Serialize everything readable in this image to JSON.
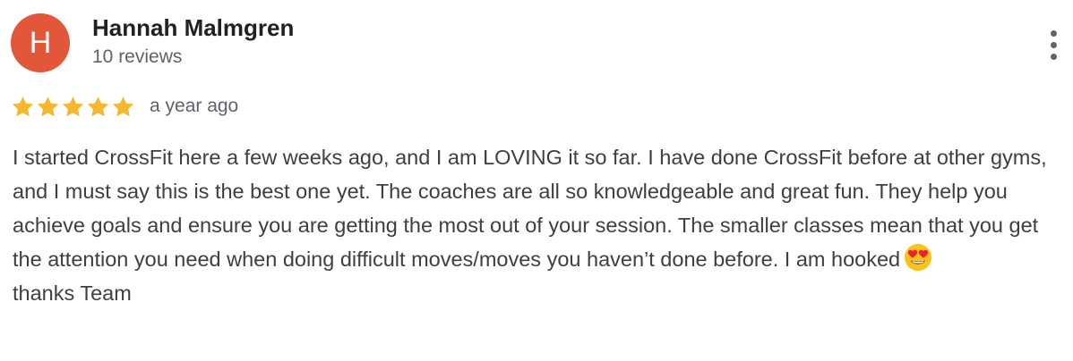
{
  "review": {
    "avatar_initial": "H",
    "avatar_color": "#e2563a",
    "author_name": "Hannah Malmgren",
    "review_count": "10 reviews",
    "rating": 5,
    "rating_max": 5,
    "star_color": "#f5b82e",
    "date": "a year ago",
    "body": "I started CrossFit here a few weeks ago, and I am LOVING it so far. I have done CrossFit before at other gyms, and I must say this is the best one yet. The coaches are all so knowledgeable and great fun. They help you achieve goals and ensure you are getting the most out of your session. The smaller classes mean that you get the attention you need when doing difficult moves/moves you haven’t done before. I am hooked",
    "body_emoji": "heart-eyes-emoji",
    "closing": "thanks Team",
    "more_icon": "more-vertical-icon"
  }
}
